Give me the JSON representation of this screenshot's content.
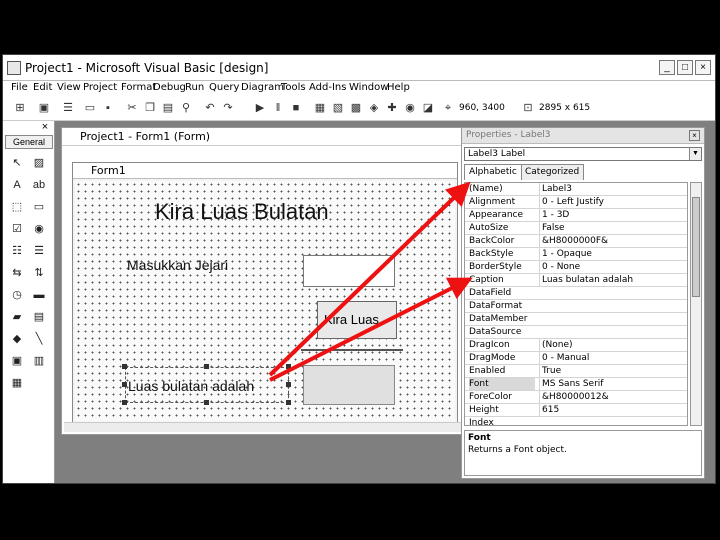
{
  "window": {
    "title": "Project1 - Microsoft Visual Basic [design]",
    "min": "_",
    "max": "□",
    "close": "×"
  },
  "menu": [
    "File",
    "Edit",
    "View",
    "Project",
    "Format",
    "Debug",
    "Run",
    "Query",
    "Diagram",
    "Tools",
    "Add-Ins",
    "Window",
    "Help"
  ],
  "toolbar": {
    "position": "960, 3400",
    "size": "2895 x 615"
  },
  "toolbox": {
    "close": "×",
    "header": "General"
  },
  "project_window": {
    "title": "Project1 - Form1 (Form)"
  },
  "form": {
    "title": "Form1",
    "label_title": "Kira Luas Bulatan",
    "label_input": "Masukkan Jejari",
    "button": "Kira Luas",
    "label_result": "Luas bulatan adalah"
  },
  "properties": {
    "title": "Properties - Label3",
    "object": "Label3  Label",
    "tabs": [
      "Alphabetic",
      "Categorized"
    ],
    "rows": [
      {
        "name": "(Name)",
        "value": "Label3"
      },
      {
        "name": "Alignment",
        "value": "0 - Left Justify"
      },
      {
        "name": "Appearance",
        "value": "1 - 3D"
      },
      {
        "name": "AutoSize",
        "value": "False"
      },
      {
        "name": "BackColor",
        "value": "&H8000000F&"
      },
      {
        "name": "BackStyle",
        "value": "1 - Opaque"
      },
      {
        "name": "BorderStyle",
        "value": "0 - None"
      },
      {
        "name": "Caption",
        "value": "Luas bulatan adalah"
      },
      {
        "name": "DataField",
        "value": ""
      },
      {
        "name": "DataFormat",
        "value": ""
      },
      {
        "name": "DataMember",
        "value": ""
      },
      {
        "name": "DataSource",
        "value": ""
      },
      {
        "name": "DragIcon",
        "value": "(None)"
      },
      {
        "name": "DragMode",
        "value": "0 - Manual"
      },
      {
        "name": "Enabled",
        "value": "True"
      },
      {
        "name": "Font",
        "value": "MS Sans Serif"
      },
      {
        "name": "ForeColor",
        "value": "&H80000012&"
      },
      {
        "name": "Height",
        "value": "615"
      },
      {
        "name": "Index",
        "value": ""
      }
    ],
    "description_title": "Font",
    "description_text": "Returns a Font object."
  },
  "colors": {
    "arrow": "#ee1111",
    "mdi_bg": "#7f7f7f"
  }
}
